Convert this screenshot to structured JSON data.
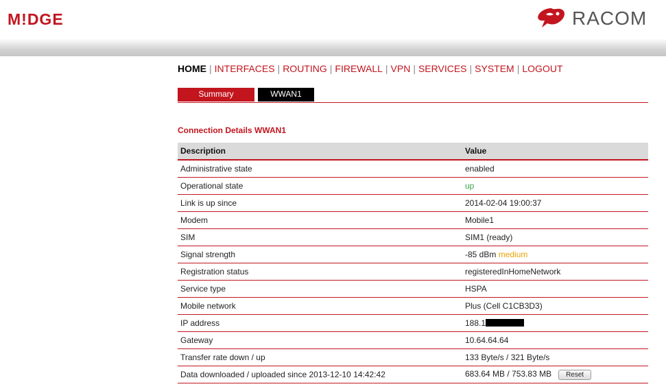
{
  "header": {
    "brand_left": "M!DGE",
    "brand_right": "RACOM",
    "brand_color": "#c2151e"
  },
  "nav": {
    "items": [
      {
        "label": "HOME",
        "active": true
      },
      {
        "label": "INTERFACES"
      },
      {
        "label": "ROUTING"
      },
      {
        "label": "FIREWALL"
      },
      {
        "label": "VPN"
      },
      {
        "label": "SERVICES"
      },
      {
        "label": "SYSTEM"
      },
      {
        "label": "LOGOUT"
      }
    ],
    "separator": "|"
  },
  "tabs": {
    "summary": "Summary",
    "wwan1": "WWAN1"
  },
  "section": {
    "title": "Connection Details WWAN1"
  },
  "table": {
    "headers": {
      "description": "Description",
      "value": "Value"
    },
    "rows": [
      {
        "label": "Administrative state",
        "value": "enabled"
      },
      {
        "label": "Operational state",
        "value": "up"
      },
      {
        "label": "Link is up since",
        "value": "2014-02-04 19:00:37"
      },
      {
        "label": "Modem",
        "value": "Mobile1"
      },
      {
        "label": "SIM",
        "value": "SIM1 (ready)"
      },
      {
        "label": "Signal strength",
        "value": "-85 dBm",
        "quality": "medium"
      },
      {
        "label": "Registration status",
        "value": "registeredInHomeNetwork"
      },
      {
        "label": "Service type",
        "value": "HSPA"
      },
      {
        "label": "Mobile network",
        "value": "Plus (Cell C1CB3D3)"
      },
      {
        "label": "IP address",
        "value": "188.1"
      },
      {
        "label": "Gateway",
        "value": "10.64.64.64"
      },
      {
        "label": "Transfer rate down / up",
        "value": "133 Byte/s / 321 Byte/s"
      },
      {
        "label": "Data downloaded / uploaded since 2013-12-10 14:42:42",
        "value": "683.64 MB / 753.83 MB"
      }
    ],
    "reset_label": "Reset"
  },
  "colors": {
    "status_up": "#3aa34a",
    "signal_medium": "#e8a200",
    "header_bg": "#dadada"
  }
}
